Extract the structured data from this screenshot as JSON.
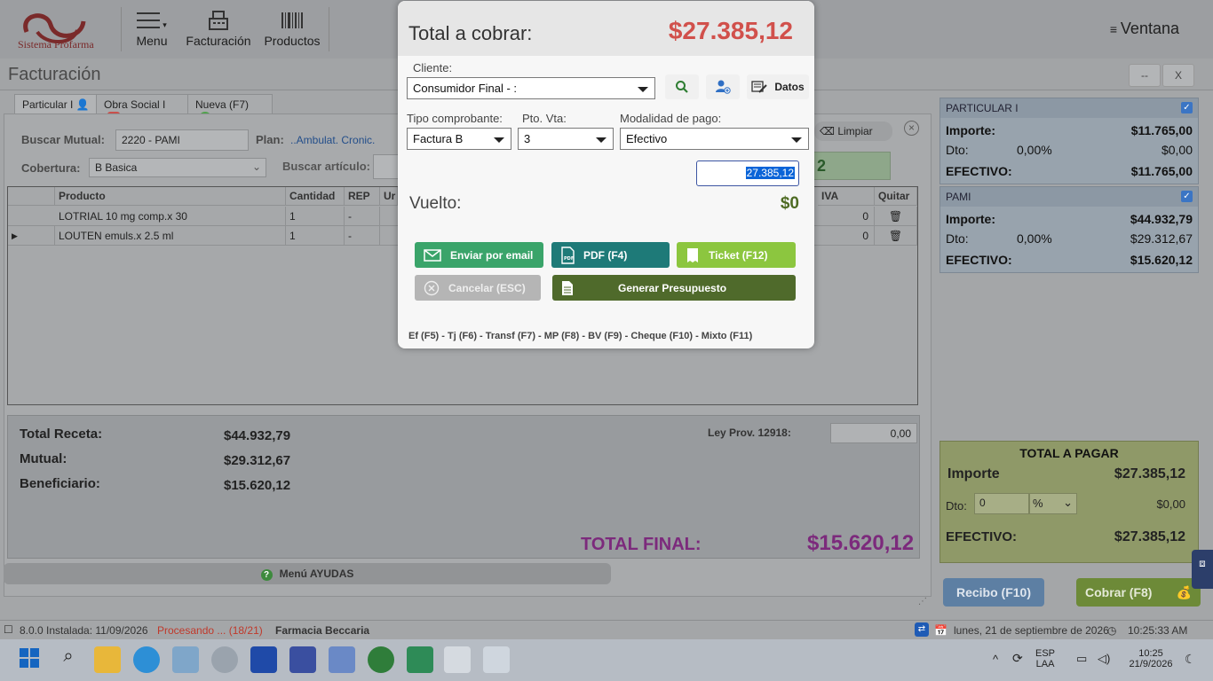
{
  "app": {
    "logo_text": "Sistema Profarma",
    "toolbar": {
      "menu": "Menu",
      "facturacion": "Facturación",
      "productos": "Productos"
    },
    "ventana": "Ventana",
    "page_title": "Facturación",
    "window_buttons": {
      "minimize": "--",
      "close": "X"
    }
  },
  "tabs": [
    {
      "label": "Particular I"
    },
    {
      "label": "Obra Social I"
    },
    {
      "label": "Nueva (F7)"
    }
  ],
  "form": {
    "buscar_mutual_label": "Buscar Mutual:",
    "buscar_mutual_value": "2220 - PAMI",
    "plan_label": "Plan:",
    "plan_value": "..Ambulat. Cronic.",
    "cobertura_label": "Cobertura:",
    "cobertura_value": "B Basica",
    "buscar_articulo_label": "Buscar artículo:",
    "limpiar": "Limpiar",
    "green_box_value": "2"
  },
  "grid": {
    "headers": {
      "producto": "Producto",
      "cantidad": "Cantidad",
      "rep": "REP",
      "un": "Ur",
      "iva": "IVA",
      "quitar": "Quitar"
    },
    "rows": [
      {
        "producto": "LOTRIAL 10 mg comp.x 30",
        "cantidad": "1",
        "rep": "-",
        "iva": "0"
      },
      {
        "producto": "LOUTEN emuls.x 2.5 ml",
        "cantidad": "1",
        "rep": "-",
        "iva": "0"
      }
    ]
  },
  "totals": {
    "receta_label": "Total Receta:",
    "receta_value": "$44.932,79",
    "mutual_label": "Mutual:",
    "mutual_value": "$29.312,67",
    "beneficiario_label": "Beneficiario:",
    "beneficiario_value": "$15.620,12",
    "ley_label": "Ley Prov. 12918:",
    "ley_value": "0,00",
    "final_label": "TOTAL FINAL:",
    "final_value": "$15.620,12",
    "ayudas": "Menú AYUDAS"
  },
  "right_panel": {
    "particular": {
      "title": "PARTICULAR I",
      "importe_label": "Importe:",
      "importe_value": "$11.765,00",
      "dto_label": "Dto:",
      "dto_pct": "0,00%",
      "dto_value": "$0,00",
      "efectivo_label": "EFECTIVO:",
      "efectivo_value": "$11.765,00"
    },
    "pami": {
      "title": "PAMI",
      "importe_label": "Importe:",
      "importe_value": "$44.932,79",
      "dto_label": "Dto:",
      "dto_pct": "0,00%",
      "dto_value": "$29.312,67",
      "efectivo_label": "EFECTIVO:",
      "efectivo_value": "$15.620,12"
    },
    "total_a_pagar": {
      "title": "TOTAL A PAGAR",
      "importe_label": "Importe",
      "importe_value": "$27.385,12",
      "dto_label": "Dto:",
      "dto_input": "0",
      "dto_unit": "%",
      "dto_value": "$0,00",
      "efectivo_label": "EFECTIVO:",
      "efectivo_value": "$27.385,12"
    },
    "recibo_button": "Recibo (F10)",
    "cobrar_button": "Cobrar (F8)"
  },
  "status_bar": {
    "version": "8.0.0 Instalada: 11/09/2026",
    "processing": "Procesando ... (18/21)",
    "farmacia": "Farmacia Beccaria",
    "date": "lunes, 21 de septiembre de 2026",
    "time": "10:25:33 AM"
  },
  "taskbar": {
    "lang": "ESP",
    "lang2": "LAA",
    "clock_time": "10:25",
    "clock_date": "21/9/2026"
  },
  "modal": {
    "title": "Total a cobrar:",
    "amount": "$27.385,12",
    "cliente_label": "Cliente:",
    "cliente_value": "Consumidor Final - :",
    "datos_button": "Datos",
    "tipo_label": "Tipo comprobante:",
    "tipo_value": "Factura B",
    "ptovta_label": "Pto. Vta:",
    "ptovta_value": "3",
    "modalidad_label": "Modalidad de pago:",
    "modalidad_value": "Efectivo",
    "amount_input": "27.385,12",
    "vuelto_label": "Vuelto:",
    "vuelto_value": "$0",
    "buttons": {
      "email": "Enviar por email",
      "pdf": "PDF (F4)",
      "ticket": "Ticket (F12)",
      "cancelar": "Cancelar (ESC)",
      "presupuesto": "Generar Presupuesto"
    },
    "shortcuts": "Ef (F5) - Tj (F6) - Transf (F7) - MP (F8) - BV (F9) - Cheque (F10) - Mixto (F11)"
  },
  "colors": {
    "total_amount": "#d1504b",
    "vuelto": "#4e6b23",
    "email_btn": "#3aa46a",
    "pdf_btn": "#1e7a78",
    "ticket_btn": "#8cc63f",
    "cancel_btn": "#b5b5b5",
    "presupuesto_btn": "#4f6a2b",
    "total_final": "#7c2a7c"
  }
}
